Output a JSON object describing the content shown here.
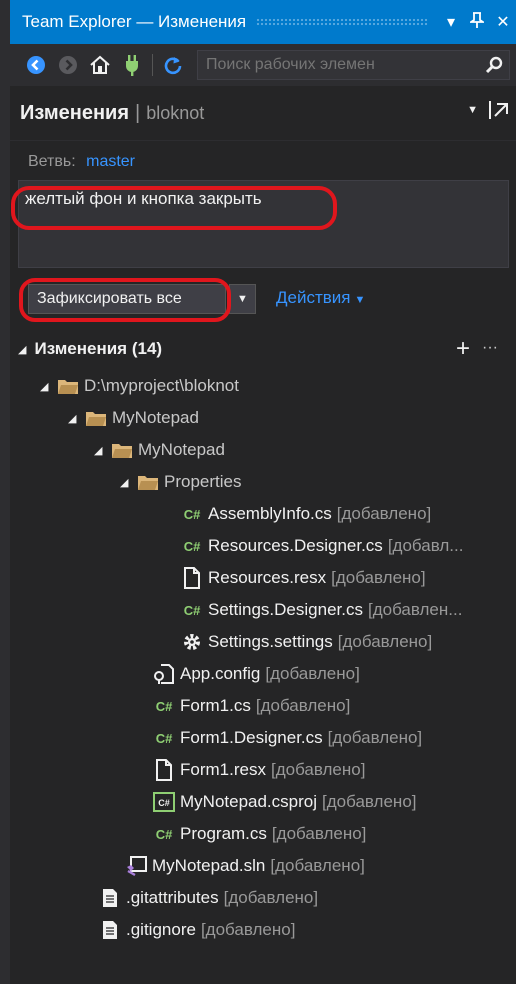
{
  "window": {
    "title": "Team Explorer — Изменения",
    "dropdown_glyph": "▾",
    "pin_glyph": "⊥",
    "close_glyph": "✕"
  },
  "toolbar": {
    "search_placeholder": "Поиск рабочих элемен",
    "icons": [
      "back-icon",
      "forward-icon",
      "home-icon",
      "connect-plug-icon",
      "refresh-icon",
      "search-icon"
    ]
  },
  "header": {
    "title": "Изменения",
    "separator": "|",
    "repo": "bloknot"
  },
  "branch": {
    "label": "Ветвь:",
    "value": "master"
  },
  "commit": {
    "message": "желтый фон и кнопка закрыть",
    "button_label": "Зафиксировать все",
    "actions_label": "Действия"
  },
  "changes": {
    "title": "Изменения (14)",
    "plus": "+",
    "more": "···",
    "status_text": "[добавлено]",
    "items": [
      {
        "name": "D:\\myproject\\bloknot",
        "status": "",
        "icon": "folder-icon"
      },
      {
        "name": "MyNotepad",
        "status": "",
        "icon": "folder-icon"
      },
      {
        "name": "MyNotepad",
        "status": "",
        "icon": "folder-icon"
      },
      {
        "name": "Properties",
        "status": "",
        "icon": "folder-icon"
      },
      {
        "name": "AssemblyInfo.cs",
        "status": "[добавлено]",
        "icon": "csharp-file-icon"
      },
      {
        "name": "Resources.Designer.cs",
        "status": "[добавл...",
        "icon": "csharp-file-icon"
      },
      {
        "name": "Resources.resx",
        "status": "[добавлено]",
        "icon": "resx-file-icon"
      },
      {
        "name": "Settings.Designer.cs",
        "status": "[добавлен...",
        "icon": "csharp-file-icon"
      },
      {
        "name": "Settings.settings",
        "status": "[добавлено]",
        "icon": "settings-gear-icon"
      },
      {
        "name": "App.config",
        "status": "[добавлено]",
        "icon": "config-file-icon"
      },
      {
        "name": "Form1.cs",
        "status": "[добавлено]",
        "icon": "csharp-file-icon"
      },
      {
        "name": "Form1.Designer.cs",
        "status": "[добавлено]",
        "icon": "csharp-file-icon"
      },
      {
        "name": "Form1.resx",
        "status": "[добавлено]",
        "icon": "resx-file-icon"
      },
      {
        "name": "MyNotepad.csproj",
        "status": "[добавлено]",
        "icon": "csproj-file-icon"
      },
      {
        "name": "Program.cs",
        "status": "[добавлено]",
        "icon": "csharp-file-icon"
      },
      {
        "name": "MyNotepad.sln",
        "status": "[добавлено]",
        "icon": "solution-file-icon"
      },
      {
        "name": ".gitattributes",
        "status": "[добавлено]",
        "icon": "text-file-icon"
      },
      {
        "name": ".gitignore",
        "status": "[добавлено]",
        "icon": "text-file-icon"
      }
    ]
  },
  "colors": {
    "accent": "#007acc",
    "link": "#3794ff",
    "highlight": "#e0161d",
    "csharp": "#8fcf73",
    "folder": "#dcb67a"
  }
}
